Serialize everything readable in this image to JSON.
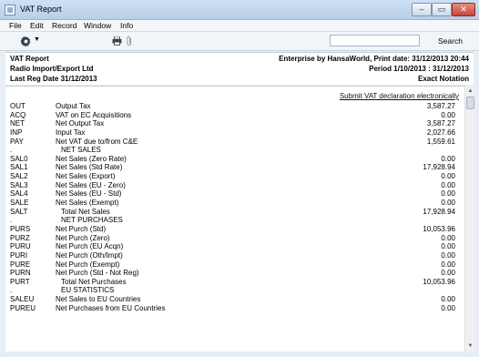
{
  "window": {
    "title": "VAT Report"
  },
  "window_controls": {
    "minimize": "–",
    "maximize": "▭",
    "close": "✕"
  },
  "menu": [
    "File",
    "Edit",
    "Record",
    "Window",
    "Info"
  ],
  "toolbar": {
    "search_label": "Search",
    "search_value": ""
  },
  "header": {
    "report_name": "VAT Report",
    "company": "Radio Import/Export Ltd",
    "last_reg": "Last Reg Date  31/12/2013",
    "enterprise": "Enterprise by HansaWorld, Print date: 31/12/2013 20:44",
    "period": "Period  1/10/2013 : 31/12/2013",
    "notation": "Exact Notation"
  },
  "content": {
    "submit_link": "Submit VAT declaration electronically",
    "rows": [
      {
        "code": "OUT",
        "desc": "Output Tax",
        "amount": "3,587.27"
      },
      {
        "code": "ACQ",
        "desc": "VAT on EC Acquisitions",
        "amount": "0.00"
      },
      {
        "code": "NET",
        "desc": "Net Output Tax",
        "amount": "3,587.27"
      },
      {
        "code": "INP",
        "desc": "Input Tax",
        "amount": "2,027.66"
      },
      {
        "code": "PAY",
        "desc": "Net VAT due to/from C&E",
        "amount": "1,559.61"
      },
      {
        "code": ".",
        "desc": "NET SALES",
        "amount": "",
        "indent": true
      },
      {
        "code": "SAL0",
        "desc": "Net Sales (Zero Rate)",
        "amount": "0.00"
      },
      {
        "code": "SAL1",
        "desc": "Net Sales (Std Rate)",
        "amount": "17,928.94"
      },
      {
        "code": "SAL2",
        "desc": "Net Sales (Export)",
        "amount": "0.00"
      },
      {
        "code": "SAL3",
        "desc": "Net Sales (EU - Zero)",
        "amount": "0.00"
      },
      {
        "code": "SAL4",
        "desc": "Net Sales (EU - Std)",
        "amount": "0.00"
      },
      {
        "code": "SALE",
        "desc": "Net Sales (Exempt)",
        "amount": "0.00"
      },
      {
        "code": "SALT",
        "desc": "Total Net Sales",
        "amount": "17,928.94",
        "indent": true
      },
      {
        "code": ".",
        "desc": "NET PURCHASES",
        "amount": "",
        "indent": true
      },
      {
        "code": "PURS",
        "desc": "Net Purch (Std)",
        "amount": "10,053.96"
      },
      {
        "code": "PURZ",
        "desc": "Net Purch (Zero)",
        "amount": "0.00"
      },
      {
        "code": "PURU",
        "desc": "Net Purch (EU Acqn)",
        "amount": "0.00"
      },
      {
        "code": "PURI",
        "desc": "Net Purch (Oth/Impt)",
        "amount": "0.00"
      },
      {
        "code": "PURE",
        "desc": "Net Purch (Exempt)",
        "amount": "0.00"
      },
      {
        "code": "PURN",
        "desc": "Net Purch (Std - Not Reg)",
        "amount": "0.00"
      },
      {
        "code": "PURT",
        "desc": "Total Net Purchases",
        "amount": "10,053.96",
        "indent": true
      },
      {
        "code": ".",
        "desc": "EU STATISTICS",
        "amount": "",
        "indent": true
      },
      {
        "code": "SALEU",
        "desc": "Net Sales to EU Countries",
        "amount": "0.00"
      },
      {
        "code": "PUREU",
        "desc": "Net Purchases from EU Countries",
        "amount": "0.00"
      }
    ]
  }
}
